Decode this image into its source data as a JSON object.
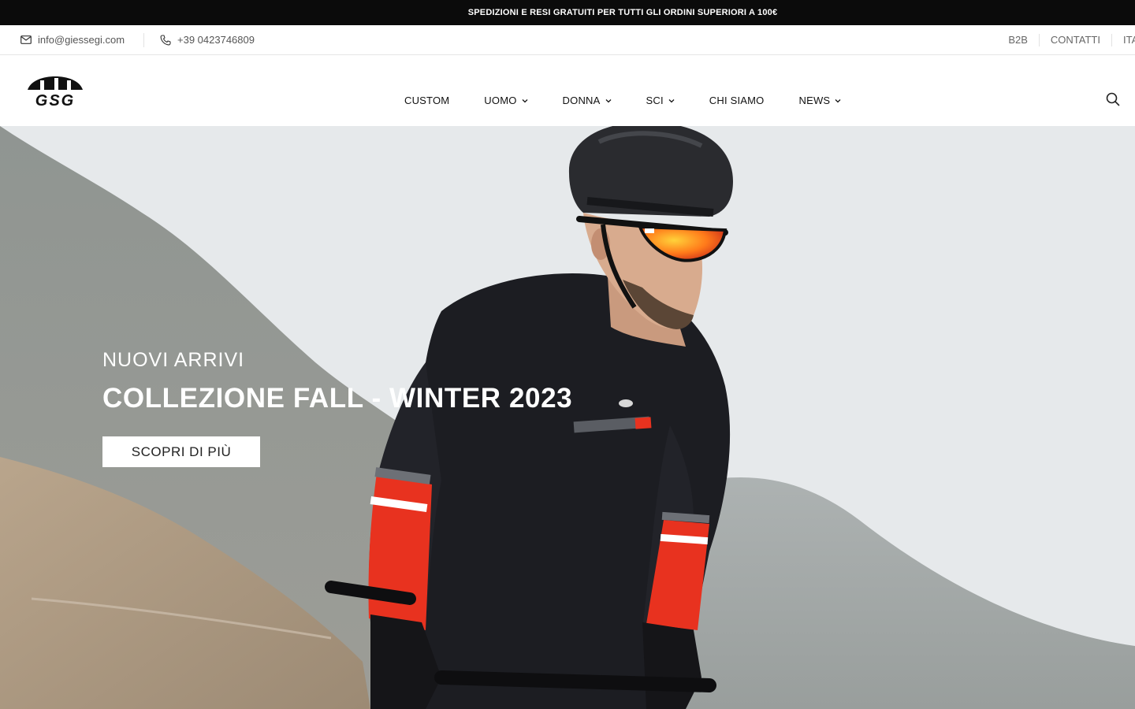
{
  "promo": {
    "text": "SPEDIZIONI E RESI GRATUITI PER TUTTI GLI ORDINI SUPERIORI A 100€"
  },
  "contact": {
    "email": "info@giessegi.com",
    "phone": "+39 0423746809",
    "links": [
      "B2B",
      "CONTATTI",
      "ITA"
    ]
  },
  "logo": {
    "text": "GSG"
  },
  "nav": {
    "items": [
      {
        "label": "CUSTOM",
        "dropdown": false
      },
      {
        "label": "UOMO",
        "dropdown": true
      },
      {
        "label": "DONNA",
        "dropdown": true
      },
      {
        "label": "SCI",
        "dropdown": true
      },
      {
        "label": "CHI SIAMO",
        "dropdown": false
      },
      {
        "label": "NEWS",
        "dropdown": true
      }
    ]
  },
  "hero": {
    "kicker": "NUOVI ARRIVI",
    "title": "COLLEZIONE FALL - WINTER 2023",
    "button": "SCOPRI DI PIÙ"
  },
  "icons": {
    "email": "mail-icon",
    "phone": "phone-icon",
    "search": "search-icon",
    "dropdown": "chevron-down-icon"
  },
  "colors": {
    "promo_bg": "#0b0b0b",
    "accent_red": "#e8321f",
    "jersey": "#1c1d22"
  }
}
